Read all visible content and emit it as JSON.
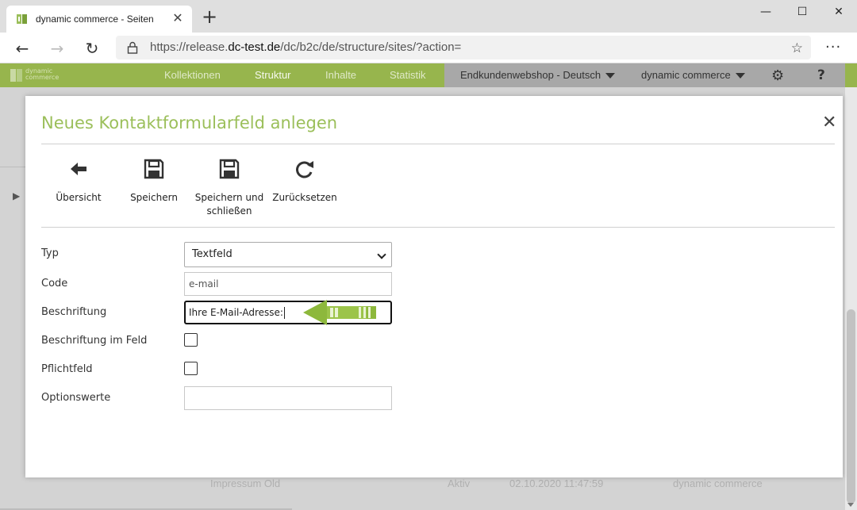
{
  "browser": {
    "tab_title": "dynamic commerce - Seiten",
    "url_prefix": "https://release.",
    "url_domain": "dc-test.de",
    "url_path": "/dc/b2c/de/structure/sites/?action="
  },
  "app": {
    "logo_line1": "dynamic",
    "logo_line2": "commerce",
    "nav": [
      "Kollektionen",
      "Struktur",
      "Inhalte",
      "Statistik"
    ],
    "active_nav": "Struktur",
    "shop_select": "Endkundenwebshop - Deutsch",
    "company_select": "dynamic commerce",
    "help_label": "?"
  },
  "background_row": {
    "name": "Impressum Old",
    "status": "Aktiv",
    "date": "02.10.2020 11:47:59",
    "user": "dynamic commerce"
  },
  "modal": {
    "title": "Neues Kontaktformularfeld anlegen",
    "toolbar": {
      "overview": "Übersicht",
      "save": "Speichern",
      "save_close_line1": "Speichern und",
      "save_close_line2": "schließen",
      "reset": "Zurücksetzen"
    },
    "form": {
      "type_label": "Typ",
      "type_value": "Textfeld",
      "code_label": "Code",
      "code_value": "e-mail",
      "caption_label": "Beschriftung",
      "caption_value": "Ihre E-Mail-Adresse:",
      "caption_in_field_label": "Beschriftung im Feld",
      "caption_in_field_checked": false,
      "required_label": "Pflichtfeld",
      "required_checked": false,
      "option_values_label": "Optionswerte",
      "option_values_value": ""
    }
  },
  "colors": {
    "brand_green": "#97b54d",
    "title_green": "#9bbf5a",
    "header_gray": "#a8a8a8"
  }
}
